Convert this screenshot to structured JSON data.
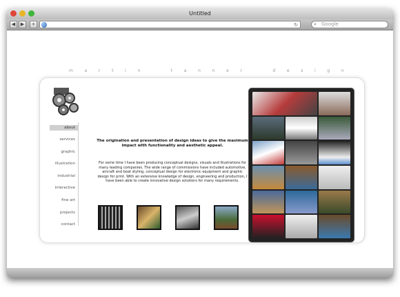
{
  "window": {
    "title": "Untitled"
  },
  "toolbar": {
    "search_placeholder": "Google",
    "back_glyph": "◀",
    "forward_glyph": "▶",
    "add_glyph": "+",
    "reload_glyph": "↻"
  },
  "site": {
    "banner": [
      "m",
      "a",
      "r",
      "t",
      "i",
      "n",
      "t",
      "a",
      "n",
      "n",
      "e",
      "r",
      "d",
      "e",
      "s",
      "i",
      "g",
      "n"
    ],
    "menu": [
      "about",
      "services",
      "graphic",
      "illustration",
      "industrial",
      "interactive",
      "fine art",
      "projects",
      "contact"
    ],
    "tagline": "The origination and presentation of design ideas to give the maximum impact with functionality and aesthetic appeal.",
    "description": "For some time I have been producing conceptual designs, visuals and illustrations for many leading companies. The wide range of commissions have included automotive, aircraft and boat styling, conceptual design for electronic equipment and graphic design for print. With an extensive knowledge of design, engineering and production, I have been able to create innovative design solutions for many requirements."
  },
  "colors": {
    "accent_red": "#e0443a",
    "accent_yellow": "#e8b524",
    "accent_green": "#3fb63a",
    "gallery_bg": "#222222"
  }
}
